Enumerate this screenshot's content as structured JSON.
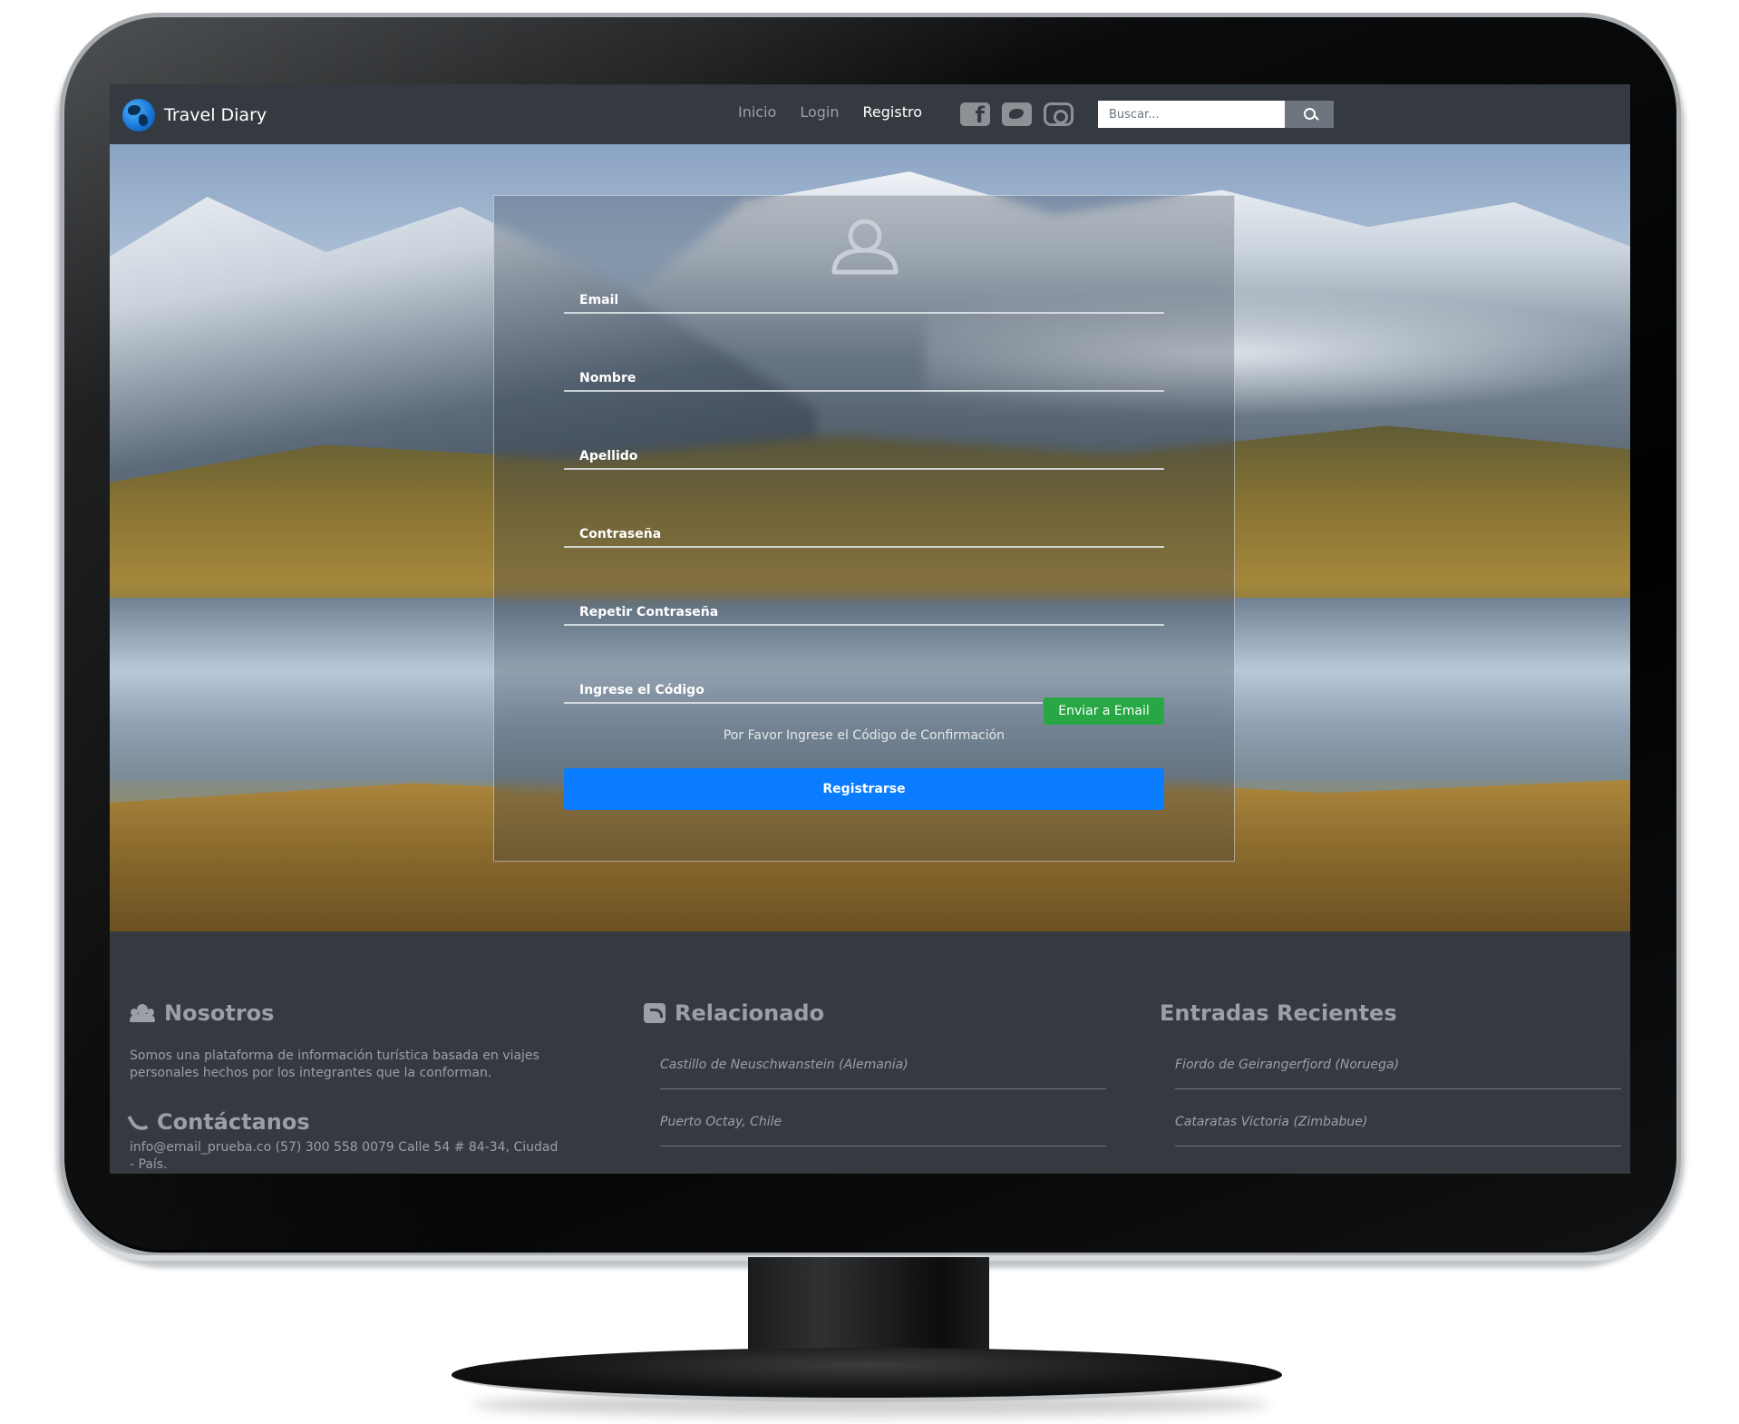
{
  "brand": {
    "name": "Travel Diary",
    "icon": "globe-icon"
  },
  "nav": {
    "links": [
      {
        "label": "Inicio",
        "active": false
      },
      {
        "label": "Login",
        "active": false
      },
      {
        "label": "Registro",
        "active": true
      }
    ],
    "social": [
      "facebook-icon",
      "twitter-icon",
      "instagram-icon"
    ]
  },
  "search": {
    "placeholder": "Buscar...",
    "button_icon": "search-icon"
  },
  "form": {
    "avatar_icon": "user-icon",
    "fields": {
      "email": "Email",
      "nombre": "Nombre",
      "apellido": "Apellido",
      "password": "Contraseña",
      "repeat_password": "Repetir Contraseña",
      "code": "Ingrese el Código"
    },
    "send_email_label": "Enviar a Email",
    "code_hint": "Por Favor Ingrese el Código de Confirmación",
    "submit_label": "Registrarse"
  },
  "footer": {
    "about": {
      "title": "Nosotros",
      "text": "Somos una plataforma de información turística basada en viajes personales hechos por los integrantes que la conforman."
    },
    "contact": {
      "title": "Contáctanos",
      "text": "info@email_prueba.co (57) 300 558 0079 Calle 54 # 84-34, Ciudad - País."
    },
    "related": {
      "title": "Relacionado",
      "items": [
        "Castillo de Neuschwanstein (Alemania)",
        "Puerto Octay, Chile"
      ]
    },
    "recent": {
      "title": "Entradas Recientes",
      "items": [
        "Fiordo de Geirangerfjord (Noruega)",
        "Cataratas Victoria (Zimbabue)"
      ]
    }
  },
  "colors": {
    "navbar": "#343a40",
    "primary": "#0a7cff",
    "success": "#28a745",
    "muted": "#9aa0a6"
  }
}
